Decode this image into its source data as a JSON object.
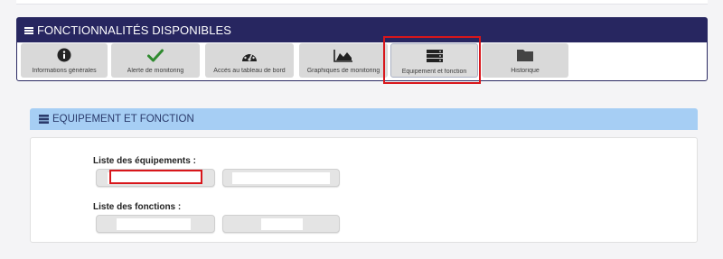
{
  "features": {
    "title": "FONCTIONNALITÉS DISPONIBLES",
    "tiles": [
      {
        "label": "Informations générales",
        "icon": "info-icon"
      },
      {
        "label": "Alerte de monitoring",
        "icon": "check-icon"
      },
      {
        "label": "Accès au tableau de bord",
        "icon": "dashboard-gauge-icon"
      },
      {
        "label": "Graphiques de monitoring",
        "icon": "area-chart-icon"
      },
      {
        "label": "Equipement et fonction",
        "icon": "server-stack-icon"
      },
      {
        "label": "Historique",
        "icon": "folder-icon"
      }
    ],
    "selected": "Equipement et fonction"
  },
  "section": {
    "title": "EQUIPEMENT ET FONCTION",
    "icon": "server-stack-icon"
  },
  "form": {
    "equipments_label": "Liste des équipements :",
    "functions_label": "Liste des fonctions :"
  },
  "colors": {
    "header_bg": "#272660",
    "section_bg": "#a6cef4",
    "highlight": "#d8161b",
    "check_green": "#2f8a2f"
  }
}
